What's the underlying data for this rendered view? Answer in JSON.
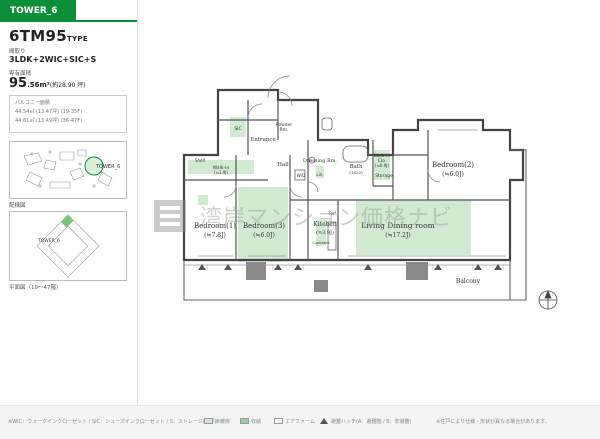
{
  "tower_tab": "TOWER_6",
  "type_name": "6TM95",
  "type_suffix": "TYPE",
  "madori_label": "間取り",
  "madori": "3LDK+2WIC+SIC+S",
  "area_label": "専有面積",
  "area_value": "95",
  "area_decimal": ".56m²",
  "area_tsubo": "(約28.90 坪)",
  "balcony_areas": [
    "バルコニー面積",
    "44.54㎡ (13.47坪) (19-35F)",
    "44.61㎡ (13.49坪) (36-47F)"
  ],
  "key_plan_label": "配棟図",
  "floor_plan_label": "平面図（19〜47階）",
  "key_plan_tower": "TOWER_6",
  "floor_plan_tower": "TOWER_6",
  "rooms": {
    "bedroom1": "Bedroom(1)",
    "bedroom1_size": "(≒7.8J)",
    "bedroom3": "Bedroom(3)",
    "bedroom3_size": "(≒6.0J)",
    "bedroom2": "Bedroom(2)",
    "bedroom2_size": "(≒6.0J)",
    "kitchen": "Kitchen",
    "kitchen_size": "(≒3.9J)",
    "ldk": "Living Dining room",
    "ldk_size": "(≒17.2J)",
    "hall": "Hall",
    "entrance": "Entrance",
    "dressing": "Dressing Rm.",
    "bath": "Bath",
    "bath_size": "(1620)",
    "powder": "Powder",
    "powder_rm": "Rm.",
    "walkin_cl": "Walk-in",
    "walkin_cl2": "Clo.",
    "walkin_size": "(≒1.9J)",
    "walkin2_size": "(≒0.9J)",
    "storage": "Storage",
    "balcony": "Balcony",
    "shelf": "Shelf",
    "sic": "SIC",
    "cupboard": "Cupboard",
    "lin": "Lin.",
    "ref": "Ref.",
    "wd": "W/D"
  },
  "watermark": "湾岸マンション価格ナビ",
  "footer": {
    "abbrev": "※WIC：ウォークインクローゼット / SIC：シューズインクローゼット / S：ストレージ(納戸)",
    "legend_floor": "床暖房",
    "legend_storage": "収納",
    "legend_ac": "エアファーム",
    "legend_hatch": "避難ハッチ(A：避難階 / B：非避難)",
    "note": "※住戸により仕様・形状が異なる場合があります。"
  },
  "colors": {
    "brand_green": "#0d8f3a",
    "floor_heating": "#d2ead2",
    "storage_gray": "#8a8a8a"
  }
}
